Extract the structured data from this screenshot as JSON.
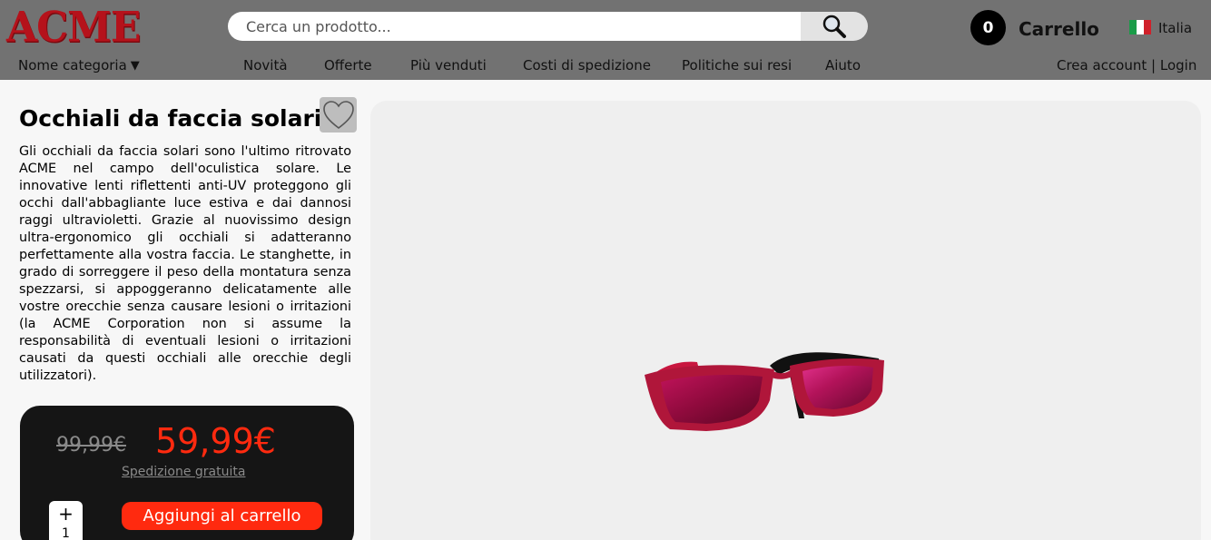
{
  "header": {
    "logo": "ACME",
    "category": "Nome categoria",
    "search_placeholder": "Cerca un prodotto...",
    "nav": [
      "Novità",
      "Offerte",
      "Più venduti",
      "Costi di spedizione",
      "Politiche sui resi",
      "Aiuto"
    ],
    "cart_count": "0",
    "cart_label": "Carrello",
    "language": "Italia",
    "create_account": "Crea account",
    "separator": "|",
    "login": "Login"
  },
  "product": {
    "title": "Occhiali da faccia solari",
    "description": "Gli occhiali da faccia solari sono l'ultimo ritrovato ACME nel campo dell'oculistica solare. Le innovative lenti riflettenti anti-UV proteggono gli occhi dall'abbagliante luce estiva e dai dannosi raggi ultravioletti. Grazie al nuovissimo design ultra-ergonomico gli occhiali si adatteranno perfettamente alla vostra faccia. Le stanghette, in grado di sorreggere il peso della montatura senza spezzarsi, si appoggeranno delicatamente alle vostre orecchie senza causare lesioni o irritazioni (la ACME Corporation non si assume la responsabilità di eventuali lesioni o irritazioni causati da questi occhiali alle orecchie degli utilizzatori).",
    "old_price": "99,99€",
    "price": "59,99€",
    "shipping": "Spedizione gratuita",
    "quantity_plus": "+",
    "quantity": "1",
    "add_to_cart": "Aggiungi al carrello"
  },
  "colors": {
    "header_bg": "#727272",
    "logo": "#b5121b",
    "accent": "#ff2a0f",
    "panel": "#151515",
    "frame": "#b0163a"
  },
  "icons": {
    "search": "magnifier-icon",
    "wishlist": "heart-outline-icon",
    "flag": "italy-flag-icon"
  }
}
